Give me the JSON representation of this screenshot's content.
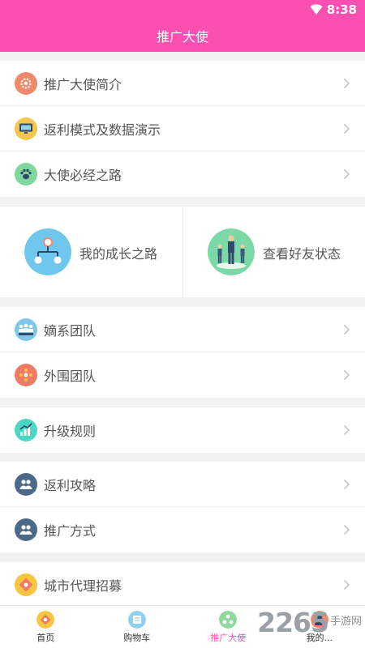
{
  "status_bar": {
    "time": "8:38"
  },
  "header": {
    "title": "推广大使"
  },
  "group1": [
    {
      "label": "推广大使简介",
      "icon": "gear-icon",
      "color": "#f08a6a"
    },
    {
      "label": "返利模式及数据演示",
      "icon": "monitor-icon",
      "color": "#f6c64a"
    },
    {
      "label": "大使必经之路",
      "icon": "paw-icon",
      "color": "#7fd89b"
    }
  ],
  "cards": [
    {
      "label": "我的成长之路",
      "icon": "flowchart-icon",
      "color": "#6fc7ee"
    },
    {
      "label": "查看好友状态",
      "icon": "people-icon",
      "color": "#7dd8a8"
    }
  ],
  "group2": [
    {
      "label": "嫡系团队",
      "icon": "team-icon",
      "color": "#7fc7ea"
    },
    {
      "label": "外围团队",
      "icon": "network-icon",
      "color": "#f07a63"
    }
  ],
  "group3": [
    {
      "label": "升级规则",
      "icon": "growth-chart-icon",
      "color": "#4ed6c4"
    }
  ],
  "group4": [
    {
      "label": "返利攻略",
      "icon": "users-icon",
      "color": "#4a6a88"
    },
    {
      "label": "推广方式",
      "icon": "users-icon",
      "color": "#4a6a88"
    }
  ],
  "group5": [
    {
      "label": "城市代理招募",
      "icon": "badge-icon",
      "color": "#f6c640"
    }
  ],
  "tabbar": [
    {
      "label": "首页",
      "icon": "home-icon",
      "color": "#f6c640",
      "active": false
    },
    {
      "label": "购物车",
      "icon": "cart-icon",
      "color": "#8fd0ee",
      "active": false
    },
    {
      "label": "推广大使",
      "icon": "ambassador-icon",
      "color": "#8fd8a0",
      "active": true
    },
    {
      "label": "我的...",
      "icon": "profile-icon",
      "color": "#f08a6a",
      "active": false
    }
  ],
  "watermark": {
    "number": "2265",
    "text_line1": "手游网",
    "text_line2": ""
  },
  "colors": {
    "brand": "#fb4fb1",
    "background": "#f2f2f2"
  }
}
